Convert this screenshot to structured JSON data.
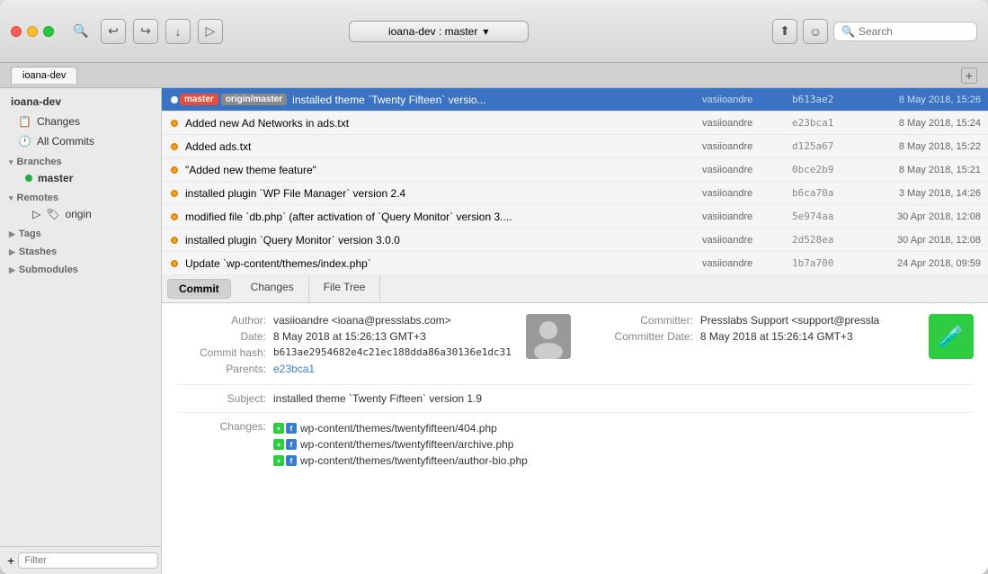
{
  "window": {
    "title": "ioana-dev",
    "repo_name": "ioana-dev",
    "branch_selector": "ioana-dev  :  master",
    "add_tab": "+"
  },
  "toolbar": {
    "search_placeholder": "Search",
    "back_icon": "←",
    "forward_icon": "→",
    "fetch_icon": "↓",
    "push_icon": "↑",
    "branch_icon": "⑂"
  },
  "sidebar": {
    "repo_name": "ioana-dev",
    "items": [
      {
        "id": "changes",
        "label": "Changes",
        "icon": "📋"
      },
      {
        "id": "all-commits",
        "label": "All Commits",
        "icon": "🕐"
      }
    ],
    "sections": [
      {
        "id": "branches",
        "label": "Branches",
        "expanded": true,
        "children": [
          {
            "id": "master",
            "label": "master",
            "active": true
          }
        ]
      },
      {
        "id": "remotes",
        "label": "Remotes",
        "expanded": true,
        "children": [
          {
            "id": "origin",
            "label": "origin"
          }
        ]
      },
      {
        "id": "tags",
        "label": "Tags",
        "expanded": false
      },
      {
        "id": "stashes",
        "label": "Stashes",
        "expanded": false
      },
      {
        "id": "submodules",
        "label": "Submodules",
        "expanded": false
      }
    ],
    "filter_placeholder": "Filter"
  },
  "commits": [
    {
      "id": 1,
      "selected": true,
      "tags": [
        "master",
        "origin/master"
      ],
      "message": "installed theme `Twenty Fifteen` versio...",
      "author": "vasiioandre",
      "hash": "b613ae2",
      "date": "8 May 2018, 15:26"
    },
    {
      "id": 2,
      "selected": false,
      "tags": [],
      "message": "Added new Ad Networks in ads.txt",
      "author": "vasiioandre",
      "hash": "e23bca1",
      "date": "8 May 2018, 15:24"
    },
    {
      "id": 3,
      "selected": false,
      "tags": [],
      "message": "Added ads.txt",
      "author": "vasiioandre",
      "hash": "d125a67",
      "date": "8 May 2018, 15:22"
    },
    {
      "id": 4,
      "selected": false,
      "tags": [],
      "message": "\"Added new theme feature\"",
      "author": "vasiioandre",
      "hash": "0bce2b9",
      "date": "8 May 2018, 15:21"
    },
    {
      "id": 5,
      "selected": false,
      "tags": [],
      "message": "installed plugin `WP File Manager` version 2.4",
      "author": "vasiioandre",
      "hash": "b6ca70a",
      "date": "3 May 2018, 14:26"
    },
    {
      "id": 6,
      "selected": false,
      "tags": [],
      "message": "modified file `db.php` (after activation of `Query Monitor` version 3....",
      "author": "vasiioandre",
      "hash": "5e974aa",
      "date": "30 Apr 2018, 12:08"
    },
    {
      "id": 7,
      "selected": false,
      "tags": [],
      "message": "installed plugin `Query Monitor` version 3.0.0",
      "author": "vasiioandre",
      "hash": "2d528ea",
      "date": "30 Apr 2018, 12:08"
    },
    {
      "id": 8,
      "selected": false,
      "tags": [],
      "message": "Update `wp-content/themes/index.php`",
      "author": "vasiioandre",
      "hash": "1b7a700",
      "date": "24 Apr 2018, 09:59"
    }
  ],
  "detail_tabs": [
    {
      "id": "commit",
      "label": "Commit",
      "active": true
    },
    {
      "id": "changes",
      "label": "Changes",
      "active": false
    },
    {
      "id": "file-tree",
      "label": "File Tree",
      "active": false
    }
  ],
  "detail": {
    "author": "vasiioandre <ioana@presslabs.com>",
    "author_label": "Author:",
    "date": "8 May 2018 at 15:26:13 GMT+3",
    "date_label": "Date:",
    "commit_hash": "b613ae2954682e4c21ec188dda86a30136e1dc31",
    "commit_hash_label": "Commit hash:",
    "parents": "e23bca1",
    "parents_label": "Parents:",
    "committer": "Presslabs Support <support@pressla",
    "committer_label": "Committer:",
    "committer_date": "8 May 2018 at 15:26:14 GMT+3",
    "committer_date_label": "Committer Date:",
    "subject": "installed theme `Twenty Fifteen` version 1.9",
    "subject_label": "Subject:",
    "changes_label": "Changes:",
    "changed_files": [
      "wp-content/themes/twentyfifteen/404.php",
      "wp-content/themes/twentyfifteen/archive.php",
      "wp-content/themes/twentyfifteen/author-bio.php"
    ]
  }
}
